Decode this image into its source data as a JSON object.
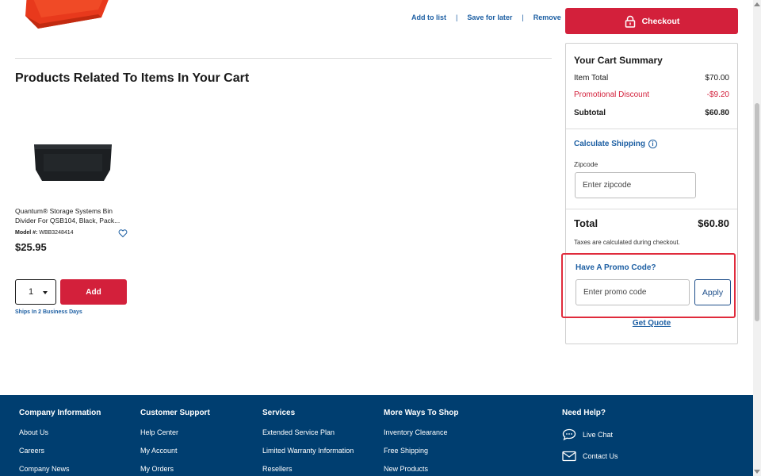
{
  "cart_item": {
    "actions": {
      "add_to_list": "Add to list",
      "save_for_later": "Save for later",
      "remove": "Remove",
      "separator": "|"
    }
  },
  "related": {
    "title": "Products Related To Items In Your Cart",
    "product": {
      "name": "Quantum® Storage Systems Bin Divider For QSB104, Black, Pack...",
      "model_label": "Model #:",
      "model_value": "WBB3248414",
      "price": "$25.95",
      "qty": "1",
      "add_label": "Add",
      "ships": "Ships In 2 Business Days"
    }
  },
  "summary": {
    "checkout_label": "Checkout",
    "title": "Your Cart Summary",
    "item_total_label": "Item Total",
    "item_total_value": "$70.00",
    "promo_discount_label": "Promotional Discount",
    "promo_discount_value": "-$9.20",
    "subtotal_label": "Subtotal",
    "subtotal_value": "$60.80",
    "calc_shipping": "Calculate Shipping",
    "zip_label": "Zipcode",
    "zip_placeholder": "Enter zipcode",
    "total_label": "Total",
    "total_value": "$60.80",
    "taxes_note": "Taxes are calculated during checkout.",
    "promo_title": "Have A Promo Code?",
    "promo_placeholder": "Enter promo code",
    "apply_label": "Apply",
    "get_quote": "Get Quote"
  },
  "footer": {
    "company": {
      "head": "Company Information",
      "links": [
        "About Us",
        "Careers",
        "Company News"
      ]
    },
    "support": {
      "head": "Customer Support",
      "links": [
        "Help Center",
        "My Account",
        "My Orders"
      ]
    },
    "services": {
      "head": "Services",
      "links": [
        "Extended Service Plan",
        "Limited Warranty Information",
        "Resellers"
      ]
    },
    "more": {
      "head": "More Ways To Shop",
      "links": [
        "Inventory Clearance",
        "Free Shipping",
        "New Products"
      ]
    },
    "help": {
      "head": "Need Help?",
      "live_chat": "Live Chat",
      "contact_us": "Contact Us"
    }
  },
  "colors": {
    "brand_red": "#d3203b",
    "link_blue": "#1d5fa3",
    "footer_bg": "#003e70",
    "highlight": "#e02b3c"
  }
}
